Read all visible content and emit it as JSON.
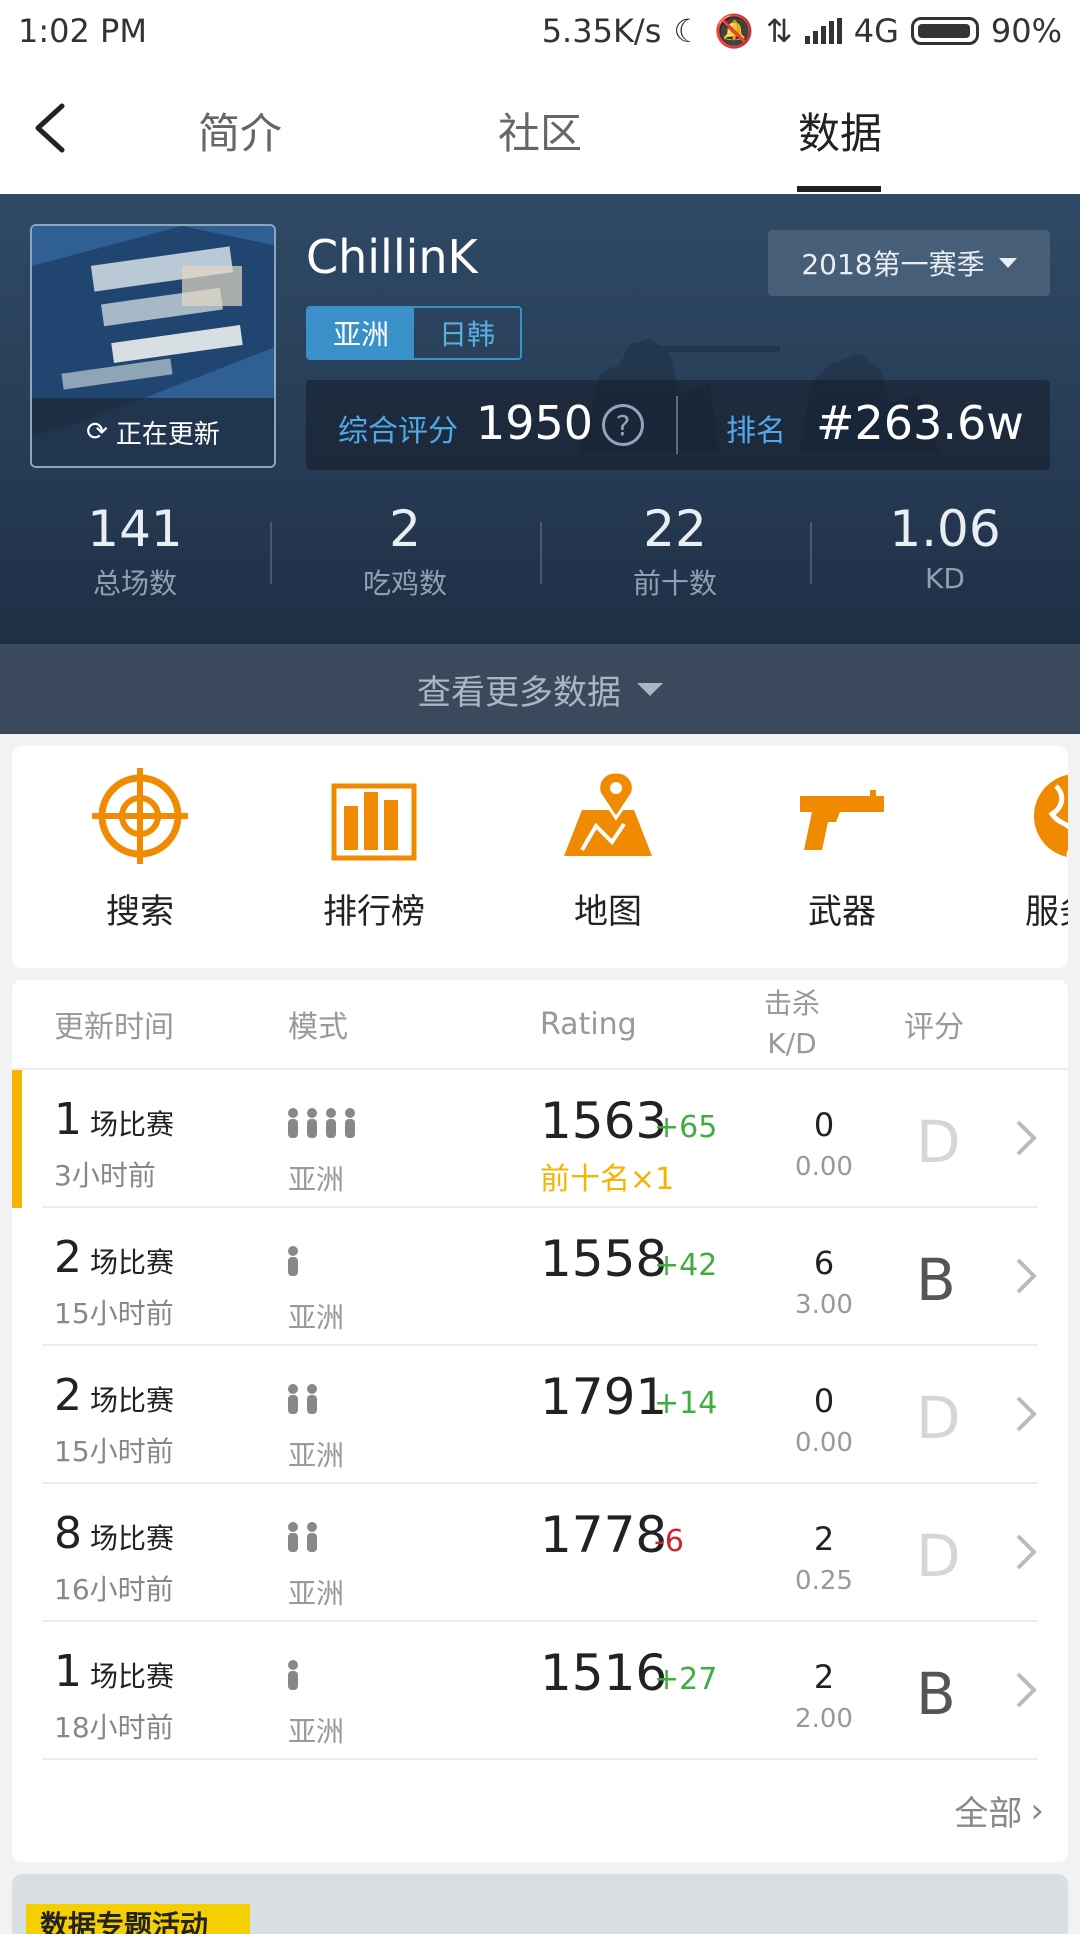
{
  "status_bar": {
    "time": "1:02 PM",
    "network_speed": "5.35K/s",
    "network_type": "4G",
    "battery": "90%"
  },
  "nav": {
    "tabs": [
      "简介",
      "社区",
      "数据"
    ],
    "active_tab": "数据"
  },
  "profile": {
    "name": "ChillinK",
    "avatar_status": "正在更新",
    "regions": [
      "亚洲",
      "日韩"
    ],
    "active_region": "亚洲",
    "season": "2018第一赛季",
    "score_label": "综合评分",
    "score": "1950",
    "help_symbol": "?",
    "rank_label": "排名",
    "rank": "#263.6w"
  },
  "summary_stats": [
    {
      "value": "141",
      "label": "总场数"
    },
    {
      "value": "2",
      "label": "吃鸡数"
    },
    {
      "value": "22",
      "label": "前十数"
    },
    {
      "value": "1.06",
      "label": "KD"
    }
  ],
  "more_data_label": "查看更多数据",
  "menu": [
    {
      "label": "搜索",
      "icon": "crosshair-icon"
    },
    {
      "label": "排行榜",
      "icon": "bar-chart-icon"
    },
    {
      "label": "地图",
      "icon": "map-icon"
    },
    {
      "label": "武器",
      "icon": "pistol-icon"
    },
    {
      "label": "服务器",
      "icon": "globe-icon"
    }
  ],
  "matches": {
    "headers": {
      "time": "更新时间",
      "mode": "模式",
      "rating": "Rating",
      "kills": "击杀",
      "kd": "K/D",
      "grade": "评分"
    },
    "rows": [
      {
        "count": "1",
        "unit": "场比赛",
        "time": "3小时前",
        "players": 4,
        "region": "亚洲",
        "rating": "1563",
        "delta": "+65",
        "delta_color": "#3fae3f",
        "note": "前十名×1",
        "kills": "0",
        "kd": "0.00",
        "grade": "D",
        "grade_color": "#d6d6d6",
        "highlight": true
      },
      {
        "count": "2",
        "unit": "场比赛",
        "time": "15小时前",
        "players": 1,
        "region": "亚洲",
        "rating": "1558",
        "delta": "+42",
        "delta_color": "#3fae3f",
        "note": "",
        "kills": "6",
        "kd": "3.00",
        "grade": "B",
        "grade_color": "#555555",
        "highlight": false
      },
      {
        "count": "2",
        "unit": "场比赛",
        "time": "15小时前",
        "players": 2,
        "region": "亚洲",
        "rating": "1791",
        "delta": "+14",
        "delta_color": "#3fae3f",
        "note": "",
        "kills": "0",
        "kd": "0.00",
        "grade": "D",
        "grade_color": "#d6d6d6",
        "highlight": false
      },
      {
        "count": "8",
        "unit": "场比赛",
        "time": "16小时前",
        "players": 2,
        "region": "亚洲",
        "rating": "1778",
        "delta": "-6",
        "delta_color": "#d0242f",
        "note": "",
        "kills": "2",
        "kd": "0.25",
        "grade": "D",
        "grade_color": "#d6d6d6",
        "highlight": false
      },
      {
        "count": "1",
        "unit": "场比赛",
        "time": "18小时前",
        "players": 1,
        "region": "亚洲",
        "rating": "1516",
        "delta": "+27",
        "delta_color": "#3fae3f",
        "note": "",
        "kills": "2",
        "kd": "2.00",
        "grade": "B",
        "grade_color": "#555555",
        "highlight": false
      }
    ],
    "all_label": "全部"
  },
  "banner": {
    "tag": "数据专题活动"
  },
  "colors": {
    "accent_orange": "#f08a00",
    "accent_blue": "#3a90c8",
    "highlight": "#f6b400"
  }
}
